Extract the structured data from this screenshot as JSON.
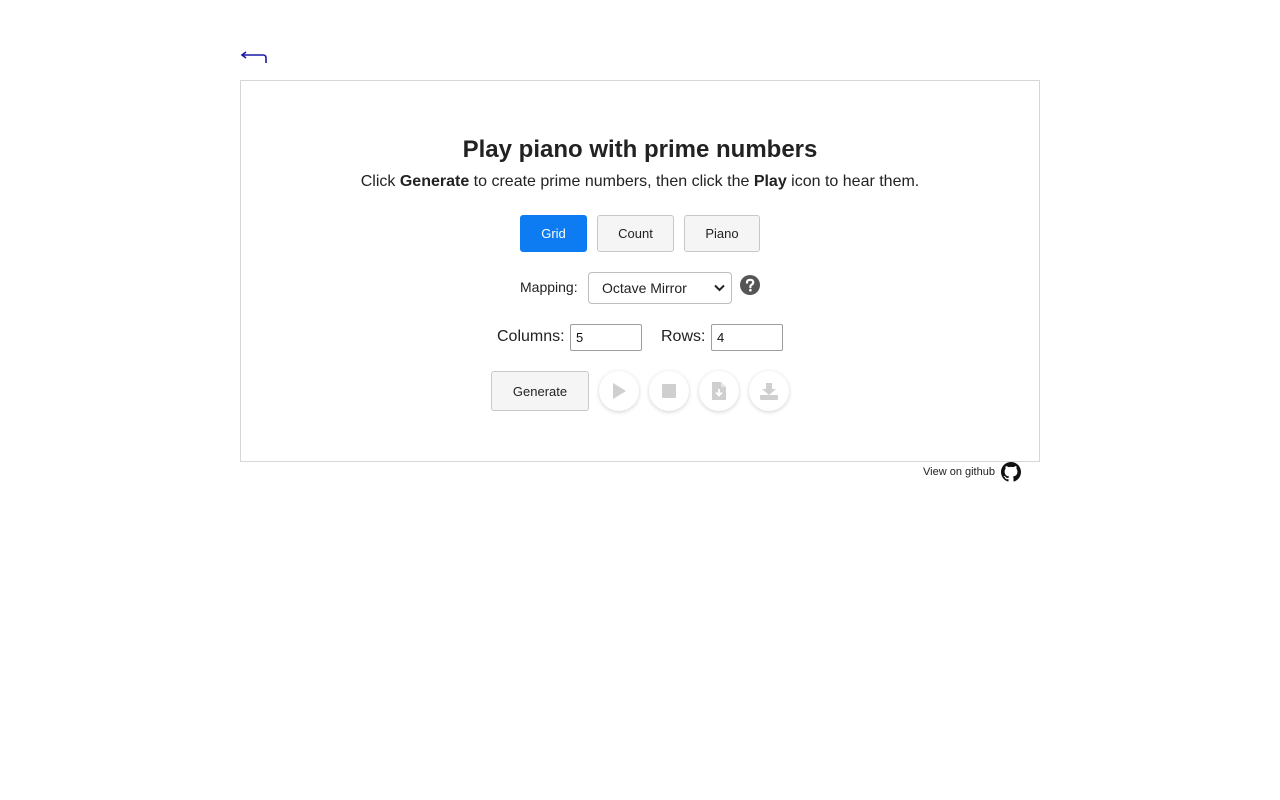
{
  "header": {
    "back_icon": "return-arrow-icon",
    "back_color": "#1a1aa6"
  },
  "card": {
    "title": "Play piano with prime numbers",
    "subtitle": {
      "prefix": "Click ",
      "generate_word": "Generate",
      "middle": " to create prime numbers, then click the ",
      "play_word": "Play",
      "suffix": " icon to hear them."
    },
    "tabs": [
      {
        "label": "Grid",
        "active": true
      },
      {
        "label": "Count",
        "active": false
      },
      {
        "label": "Piano",
        "active": false
      }
    ],
    "mapping": {
      "label": "Mapping:",
      "selected": "Octave Mirror",
      "help_icon": "question-circle-icon"
    },
    "dimensions": {
      "columns_label": "Columns:",
      "columns_value": "5",
      "rows_label": "Rows:",
      "rows_value": "4"
    },
    "actions": {
      "generate_label": "Generate",
      "icons": [
        "play-icon",
        "stop-icon",
        "file-download-icon",
        "download-icon"
      ]
    }
  },
  "footer": {
    "github_label": "View on github",
    "github_icon": "github-icon"
  },
  "colors": {
    "accent": "#0d7cf2",
    "disabled_icon": "#cfcfcf",
    "help_icon": "#555555"
  }
}
